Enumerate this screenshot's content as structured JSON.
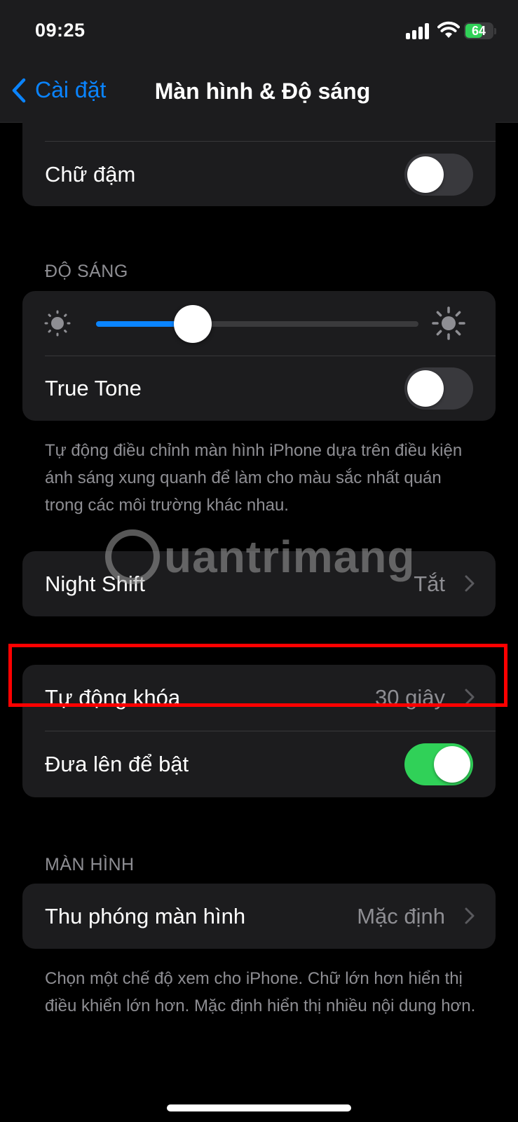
{
  "status_bar": {
    "time": "09:25",
    "battery": "64"
  },
  "nav": {
    "back_label": "Cài đặt",
    "title": "Màn hình & Độ sáng"
  },
  "text_section": {
    "bold_text_label": "Chữ đậm",
    "bold_text_on": false
  },
  "brightness": {
    "header": "ĐỘ SÁNG",
    "level_fraction": 0.3,
    "true_tone_label": "True Tone",
    "true_tone_on": false,
    "footnote": "Tự động điều chỉnh màn hình iPhone dựa trên điều kiện ánh sáng xung quanh để làm cho màu sắc nhất quán trong các môi trường khác nhau."
  },
  "night_shift": {
    "label": "Night Shift",
    "value": "Tắt"
  },
  "lock": {
    "auto_lock_label": "Tự động khóa",
    "auto_lock_value": "30 giây",
    "raise_to_wake_label": "Đưa lên để bật",
    "raise_to_wake_on": true
  },
  "display": {
    "header": "MÀN HÌNH",
    "zoom_label": "Thu phóng màn hình",
    "zoom_value": "Mặc định",
    "footnote": "Chọn một chế độ xem cho iPhone. Chữ lớn hơn hiển thị điều khiển lớn hơn. Mặc định hiển thị nhiều nội dung hơn."
  },
  "watermark": {
    "text": "uantrimang"
  },
  "colors": {
    "accent": "#0a84ff",
    "toggle_on": "#30d158",
    "highlight": "#ff0000",
    "cell_bg": "#1c1c1e"
  },
  "icons": [
    "chevron-left-icon",
    "chevron-right-icon",
    "sun-small-icon",
    "sun-large-icon",
    "signal-icon",
    "wifi-icon",
    "battery-icon"
  ]
}
